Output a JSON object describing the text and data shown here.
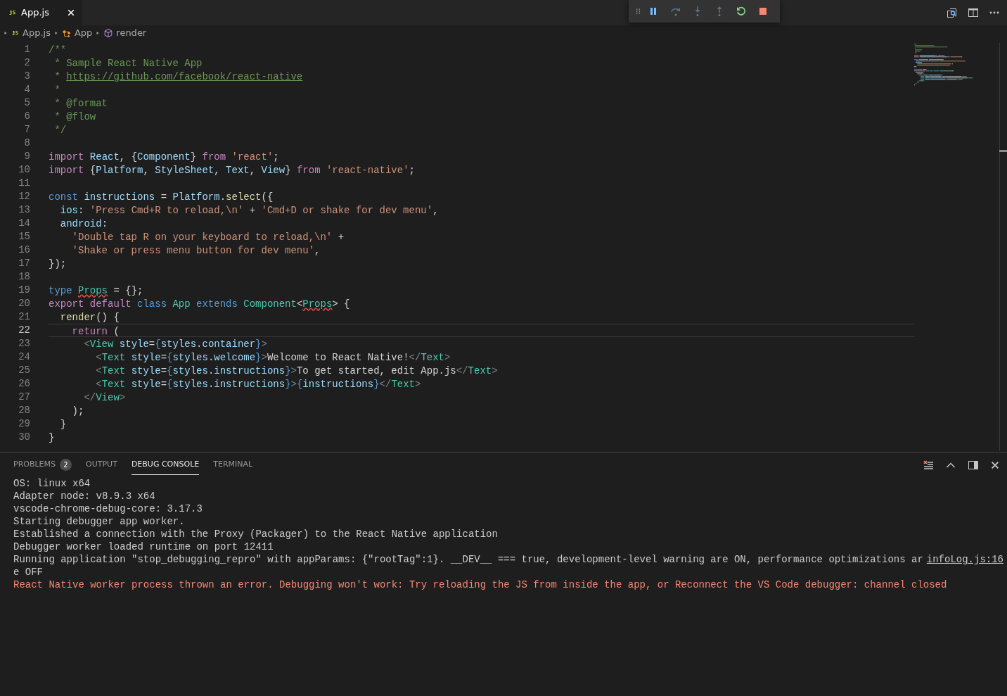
{
  "editor_tabs": [
    {
      "label": "App.js",
      "selected": true
    }
  ],
  "debug_toolbar": [
    {
      "kind": "pause",
      "disabled": false
    },
    {
      "kind": "step-over",
      "disabled": true
    },
    {
      "kind": "step-into",
      "disabled": true
    },
    {
      "kind": "step-out",
      "disabled": true
    },
    {
      "kind": "restart",
      "disabled": false
    },
    {
      "kind": "stop",
      "disabled": false
    }
  ],
  "breadcrumbs": [
    {
      "kind": "file",
      "label": "App.js"
    },
    {
      "kind": "class",
      "label": "App"
    },
    {
      "kind": "method",
      "label": "render"
    }
  ],
  "code_lines": [
    {
      "number": "1",
      "current": false,
      "tokens": [
        {
          "kind": "comment",
          "text": "/**"
        }
      ]
    },
    {
      "number": "2",
      "current": false,
      "tokens": [
        {
          "kind": "comment",
          "text": " * Sample React Native App"
        }
      ]
    },
    {
      "number": "3",
      "current": false,
      "tokens": [
        {
          "kind": "comment",
          "text": " * "
        },
        {
          "kind": "comment-link",
          "text": "https://github.com/facebook/react-native"
        }
      ]
    },
    {
      "number": "4",
      "current": false,
      "tokens": [
        {
          "kind": "comment",
          "text": " *"
        }
      ]
    },
    {
      "number": "5",
      "current": false,
      "tokens": [
        {
          "kind": "comment",
          "text": " * @format"
        }
      ]
    },
    {
      "number": "6",
      "current": false,
      "tokens": [
        {
          "kind": "comment",
          "text": " * @flow"
        }
      ]
    },
    {
      "number": "7",
      "current": false,
      "tokens": [
        {
          "kind": "comment",
          "text": " */"
        }
      ]
    },
    {
      "number": "8",
      "current": false
    },
    {
      "number": "9",
      "current": false,
      "tokens": [
        {
          "kind": "control",
          "text": "import"
        },
        {
          "kind": "variable",
          "text": " React"
        },
        {
          "kind": "plain",
          "text": ", {"
        },
        {
          "kind": "variable",
          "text": "Component"
        },
        {
          "kind": "plain",
          "text": "} "
        },
        {
          "kind": "control",
          "text": "from"
        },
        {
          "kind": "string",
          "text": " 'react'"
        },
        {
          "kind": "plain",
          "text": ";"
        }
      ]
    },
    {
      "number": "10",
      "current": false,
      "tokens": [
        {
          "kind": "control",
          "text": "import"
        },
        {
          "kind": "plain",
          "text": " {"
        },
        {
          "kind": "variable",
          "text": "Platform"
        },
        {
          "kind": "plain",
          "text": ", "
        },
        {
          "kind": "variable",
          "text": "StyleSheet"
        },
        {
          "kind": "plain",
          "text": ", "
        },
        {
          "kind": "variable",
          "text": "Text"
        },
        {
          "kind": "plain",
          "text": ", "
        },
        {
          "kind": "variable",
          "text": "View"
        },
        {
          "kind": "plain",
          "text": "} "
        },
        {
          "kind": "control",
          "text": "from"
        },
        {
          "kind": "string",
          "text": " 'react-native'"
        },
        {
          "kind": "plain",
          "text": ";"
        }
      ]
    },
    {
      "number": "11",
      "current": false
    },
    {
      "number": "12",
      "current": false,
      "tokens": [
        {
          "kind": "keyword",
          "text": "const"
        },
        {
          "kind": "variable",
          "text": " instructions"
        },
        {
          "kind": "plain",
          "text": " = "
        },
        {
          "kind": "variable",
          "text": "Platform"
        },
        {
          "kind": "plain",
          "text": "."
        },
        {
          "kind": "function",
          "text": "select"
        },
        {
          "kind": "plain",
          "text": "({"
        }
      ]
    },
    {
      "number": "13",
      "current": false,
      "tokens": [
        {
          "kind": "variable",
          "text": "  ios"
        },
        {
          "kind": "plain",
          "text": ": "
        },
        {
          "kind": "string",
          "text": "'Press Cmd+R to reload,\\n'"
        },
        {
          "kind": "plain",
          "text": " + "
        },
        {
          "kind": "string",
          "text": "'Cmd+D or shake for dev menu'"
        },
        {
          "kind": "plain",
          "text": ","
        }
      ]
    },
    {
      "number": "14",
      "current": false,
      "tokens": [
        {
          "kind": "variable",
          "text": "  android"
        },
        {
          "kind": "plain",
          "text": ":"
        }
      ]
    },
    {
      "number": "15",
      "current": false,
      "tokens": [
        {
          "kind": "string",
          "text": "    'Double tap R on your keyboard to reload,\\n'"
        },
        {
          "kind": "plain",
          "text": " +"
        }
      ]
    },
    {
      "number": "16",
      "current": false,
      "tokens": [
        {
          "kind": "string",
          "text": "    'Shake or press menu button for dev menu'"
        },
        {
          "kind": "plain",
          "text": ","
        }
      ]
    },
    {
      "number": "17",
      "current": false,
      "tokens": [
        {
          "kind": "plain",
          "text": "});"
        }
      ]
    },
    {
      "number": "18",
      "current": false
    },
    {
      "number": "19",
      "current": false,
      "tokens": [
        {
          "kind": "keyword",
          "text": "type "
        },
        {
          "kind": "type-error",
          "text": "Props"
        },
        {
          "kind": "plain",
          "text": " = {};"
        }
      ]
    },
    {
      "number": "20",
      "current": false,
      "tokens": [
        {
          "kind": "control",
          "text": "export default"
        },
        {
          "kind": "keyword",
          "text": " class"
        },
        {
          "kind": "type",
          "text": " App"
        },
        {
          "kind": "keyword",
          "text": " extends"
        },
        {
          "kind": "type",
          "text": " Component"
        },
        {
          "kind": "plain",
          "text": "<"
        },
        {
          "kind": "type-error",
          "text": "Props"
        },
        {
          "kind": "plain",
          "text": "> {"
        }
      ]
    },
    {
      "number": "21",
      "current": false,
      "tokens": [
        {
          "kind": "function",
          "text": "  render"
        },
        {
          "kind": "plain",
          "text": "() {"
        }
      ]
    },
    {
      "number": "22",
      "current": true,
      "tokens": [
        {
          "kind": "control",
          "text": "    return"
        },
        {
          "kind": "plain",
          "text": " ("
        }
      ]
    },
    {
      "number": "23",
      "current": false,
      "tokens": [
        {
          "kind": "tag-bracket",
          "text": "      <"
        },
        {
          "kind": "type",
          "text": "View"
        },
        {
          "kind": "variable",
          "text": " style"
        },
        {
          "kind": "plain",
          "text": "="
        },
        {
          "kind": "jsx-brace",
          "text": "{"
        },
        {
          "kind": "variable",
          "text": "styles"
        },
        {
          "kind": "plain",
          "text": "."
        },
        {
          "kind": "variable",
          "text": "container"
        },
        {
          "kind": "jsx-brace",
          "text": "}"
        },
        {
          "kind": "tag-bracket",
          "text": ">"
        }
      ]
    },
    {
      "number": "24",
      "current": false,
      "tokens": [
        {
          "kind": "tag-bracket",
          "text": "        <"
        },
        {
          "kind": "type",
          "text": "Text"
        },
        {
          "kind": "variable",
          "text": " style"
        },
        {
          "kind": "plain",
          "text": "="
        },
        {
          "kind": "jsx-brace",
          "text": "{"
        },
        {
          "kind": "variable",
          "text": "styles"
        },
        {
          "kind": "plain",
          "text": "."
        },
        {
          "kind": "variable",
          "text": "welcome"
        },
        {
          "kind": "jsx-brace",
          "text": "}"
        },
        {
          "kind": "tag-bracket",
          "text": ">"
        },
        {
          "kind": "plain",
          "text": "Welcome to React Native!"
        },
        {
          "kind": "tag-bracket",
          "text": "</"
        },
        {
          "kind": "type",
          "text": "Text"
        },
        {
          "kind": "tag-bracket",
          "text": ">"
        }
      ]
    },
    {
      "number": "25",
      "current": false,
      "tokens": [
        {
          "kind": "tag-bracket",
          "text": "        <"
        },
        {
          "kind": "type",
          "text": "Text"
        },
        {
          "kind": "variable",
          "text": " style"
        },
        {
          "kind": "plain",
          "text": "="
        },
        {
          "kind": "jsx-brace",
          "text": "{"
        },
        {
          "kind": "variable",
          "text": "styles"
        },
        {
          "kind": "plain",
          "text": "."
        },
        {
          "kind": "variable",
          "text": "instructions"
        },
        {
          "kind": "jsx-brace",
          "text": "}"
        },
        {
          "kind": "tag-bracket",
          "text": ">"
        },
        {
          "kind": "plain",
          "text": "To get started, edit App.js"
        },
        {
          "kind": "tag-bracket",
          "text": "</"
        },
        {
          "kind": "type",
          "text": "Text"
        },
        {
          "kind": "tag-bracket",
          "text": ">"
        }
      ]
    },
    {
      "number": "26",
      "current": false,
      "tokens": [
        {
          "kind": "tag-bracket",
          "text": "        <"
        },
        {
          "kind": "type",
          "text": "Text"
        },
        {
          "kind": "variable",
          "text": " style"
        },
        {
          "kind": "plain",
          "text": "="
        },
        {
          "kind": "jsx-brace",
          "text": "{"
        },
        {
          "kind": "variable",
          "text": "styles"
        },
        {
          "kind": "plain",
          "text": "."
        },
        {
          "kind": "variable",
          "text": "instructions"
        },
        {
          "kind": "jsx-brace",
          "text": "}"
        },
        {
          "kind": "tag-bracket",
          "text": ">"
        },
        {
          "kind": "jsx-brace",
          "text": "{"
        },
        {
          "kind": "variable",
          "text": "instructions"
        },
        {
          "kind": "jsx-brace",
          "text": "}"
        },
        {
          "kind": "tag-bracket",
          "text": "</"
        },
        {
          "kind": "type",
          "text": "Text"
        },
        {
          "kind": "tag-bracket",
          "text": ">"
        }
      ]
    },
    {
      "number": "27",
      "current": false,
      "tokens": [
        {
          "kind": "tag-bracket",
          "text": "      </"
        },
        {
          "kind": "type",
          "text": "View"
        },
        {
          "kind": "tag-bracket",
          "text": ">"
        }
      ]
    },
    {
      "number": "28",
      "current": false,
      "tokens": [
        {
          "kind": "plain",
          "text": "    );"
        }
      ]
    },
    {
      "number": "29",
      "current": false,
      "tokens": [
        {
          "kind": "plain",
          "text": "  }"
        }
      ]
    },
    {
      "number": "30",
      "current": false,
      "tokens": [
        {
          "kind": "plain",
          "text": "}"
        }
      ]
    }
  ],
  "panel_tabs": [
    {
      "label": "PROBLEMS",
      "badge": "2",
      "selected": false
    },
    {
      "label": "OUTPUT",
      "selected": false
    },
    {
      "label": "DEBUG CONSOLE",
      "selected": true
    },
    {
      "label": "TERMINAL",
      "selected": false
    }
  ],
  "console_lines": [
    {
      "kind": "info",
      "text": "OS: linux x64"
    },
    {
      "kind": "info",
      "text": "Adapter node: v8.9.3 x64"
    },
    {
      "kind": "info",
      "text": "vscode-chrome-debug-core: 3.17.3"
    },
    {
      "kind": "info",
      "text": "Starting debugger app worker."
    },
    {
      "kind": "info",
      "text": "Established a connection with the Proxy (Packager) to the React Native application"
    },
    {
      "kind": "info",
      "text": "Debugger worker loaded runtime on port 12411"
    },
    {
      "kind": "info",
      "text": "Running application \"stop_debugging_repro\" with appParams: {\"rootTag\":1}. __DEV__ === true, development-level warning are ON, performance optimizations are OFF",
      "source": "infoLog.js:16"
    },
    {
      "kind": "error",
      "text": "React Native worker process thrown an error. Debugging won't work: Try reloading the JS from inside the app, or Reconnect the VS Code debugger: channel closed"
    }
  ]
}
